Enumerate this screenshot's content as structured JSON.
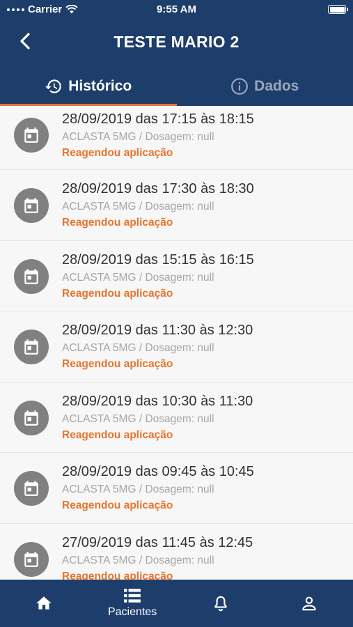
{
  "status_bar": {
    "carrier": "Carrier",
    "time": "9:55 AM"
  },
  "nav": {
    "title": "TESTE MARIO 2"
  },
  "tabs": [
    {
      "label": "Histórico",
      "icon": "history-icon",
      "active": true
    },
    {
      "label": "Dados",
      "icon": "info-icon",
      "active": false
    }
  ],
  "colors": {
    "primary": "#1d3d6b",
    "accent": "#e8742c",
    "avatar": "#808080"
  },
  "history": [
    {
      "date": "28/09/2019 das 17:15 às 18:15",
      "detail": "ACLASTA 5MG / Dosagem: null",
      "status": "Reagendou aplicação"
    },
    {
      "date": "28/09/2019 das 17:30 às 18:30",
      "detail": "ACLASTA 5MG / Dosagem: null",
      "status": "Reagendou aplicação"
    },
    {
      "date": "28/09/2019 das 15:15 às 16:15",
      "detail": "ACLASTA 5MG / Dosagem: null",
      "status": "Reagendou aplicação"
    },
    {
      "date": "28/09/2019 das 11:30 às 12:30",
      "detail": "ACLASTA 5MG / Dosagem: null",
      "status": "Reagendou aplicação"
    },
    {
      "date": "28/09/2019 das 10:30 às 11:30",
      "detail": "ACLASTA 5MG / Dosagem: null",
      "status": "Reagendou aplicação"
    },
    {
      "date": "28/09/2019 das 09:45 às 10:45",
      "detail": "ACLASTA 5MG / Dosagem: null",
      "status": "Reagendou aplicação"
    },
    {
      "date": "27/09/2019 das 11:45 às 12:45",
      "detail": "ACLASTA 5MG / Dosagem: null",
      "status": "Reagendou aplicação"
    }
  ],
  "bottom_nav": [
    {
      "icon": "home-icon",
      "label": ""
    },
    {
      "icon": "list-icon",
      "label": "Pacientes"
    },
    {
      "icon": "bell-icon",
      "label": ""
    },
    {
      "icon": "user-icon",
      "label": ""
    }
  ]
}
